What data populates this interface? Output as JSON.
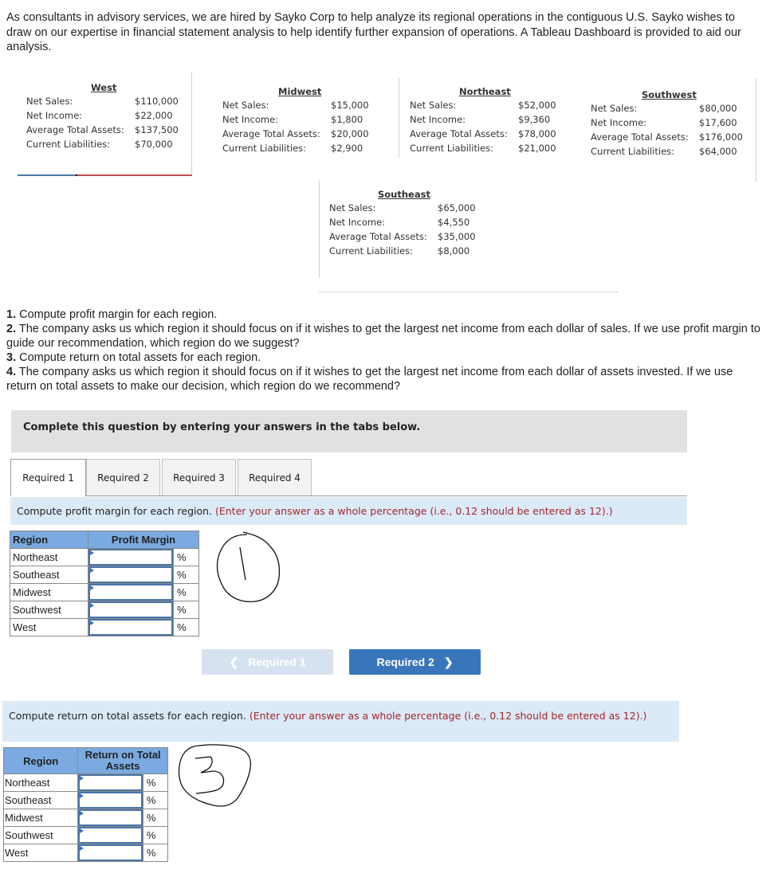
{
  "intro": "As consultants in advisory services, we are hired by Sayko Corp to help analyze its regional operations in the contiguous U.S. Sayko wishes to draw on our expertise in financial statement analysis to help identify further expansion of operations. A Tableau Dashboard is provided to aid our analysis.",
  "dashboard": {
    "labels": {
      "net_sales": "Net Sales:",
      "net_income": "Net Income:",
      "avg_total_assets": "Average Total Assets:",
      "current_liabilities": "Current Liabilities:"
    },
    "regions": {
      "west": {
        "name": "West",
        "net_sales": "$110,000",
        "net_income": "$22,000",
        "avg_total_assets": "$137,500",
        "current_liabilities": "$70,000"
      },
      "midwest": {
        "name": "Midwest",
        "net_sales": "$15,000",
        "net_income": "$1,800",
        "avg_total_assets": "$20,000",
        "current_liabilities": "$2,900"
      },
      "northeast": {
        "name": "Northeast",
        "net_sales": "$52,000",
        "net_income": "$9,360",
        "avg_total_assets": "$78,000",
        "current_liabilities": "$21,000"
      },
      "southwest": {
        "name": "Southwest",
        "net_sales": "$80,000",
        "net_income": "$17,600",
        "avg_total_assets": "$176,000",
        "current_liabilities": "$64,000"
      },
      "southeast": {
        "name": "Southeast",
        "net_sales": "$65,000",
        "net_income": "$4,550",
        "avg_total_assets": "$35,000",
        "current_liabilities": "$8,000"
      }
    },
    "colors": {
      "west_bar_blue": "#4e79a7",
      "west_bar_red": "#c0504d"
    }
  },
  "questions": [
    {
      "num": "1.",
      "text": " Compute profit margin for each region."
    },
    {
      "num": "2.",
      "text": " The company asks us which region it should focus on if it wishes to get the largest net income from each dollar of sales. If we use profit margin to guide our recommendation, which region do we suggest?"
    },
    {
      "num": "3.",
      "text": " Compute return on total assets for each region."
    },
    {
      "num": "4.",
      "text": " The company asks us which region it should focus on if it wishes to get the largest net income from each dollar of assets invested. If we use return on total assets to make our decision, which region do we recommend?"
    }
  ],
  "instruction": "Complete this question by entering your answers in the tabs below.",
  "tabs": [
    {
      "label": "Required 1",
      "active": true
    },
    {
      "label": "Required 2",
      "active": false
    },
    {
      "label": "Required 3",
      "active": false
    },
    {
      "label": "Required 4",
      "active": false
    }
  ],
  "req1": {
    "prompt": "Compute profit margin for each region.",
    "prompt_note": "(Enter your answer as a whole percentage (i.e., 0.12 should be entered as 12).)",
    "table": {
      "headers": [
        "Region",
        "Profit Margin"
      ],
      "rows": [
        {
          "region": "Northeast",
          "value": "",
          "unit": "%"
        },
        {
          "region": "Southeast",
          "value": "",
          "unit": "%"
        },
        {
          "region": "Midwest",
          "value": "",
          "unit": "%"
        },
        {
          "region": "Southwest",
          "value": "",
          "unit": "%"
        },
        {
          "region": "West",
          "value": "",
          "unit": "%"
        }
      ]
    },
    "annotation": "1"
  },
  "nav": {
    "prev_label": "Required 1",
    "next_label": "Required 2",
    "prev_icon": "chevron-left",
    "next_icon": "chevron-right"
  },
  "req3": {
    "prompt": "Compute return on total assets for each region.",
    "prompt_note": "(Enter your answer as a whole percentage (i.e., 0.12 should be entered as 12).)",
    "table": {
      "headers": [
        "Region",
        "Return on Total Assets"
      ],
      "rows": [
        {
          "region": "Northeast",
          "value": "",
          "unit": "%"
        },
        {
          "region": "Southeast",
          "value": "",
          "unit": "%"
        },
        {
          "region": "Midwest",
          "value": "",
          "unit": "%"
        },
        {
          "region": "Southwest",
          "value": "",
          "unit": "%"
        },
        {
          "region": "West",
          "value": "",
          "unit": "%"
        }
      ]
    },
    "annotation": "3"
  },
  "colors": {
    "table_header": "#7aaae0",
    "prompt_bg": "#dbeaf7",
    "note_red": "#a4262c",
    "next_button": "#3875b9",
    "prev_button_disabled": "#d6e2f0",
    "instruction_bg": "#e1e1e1"
  }
}
